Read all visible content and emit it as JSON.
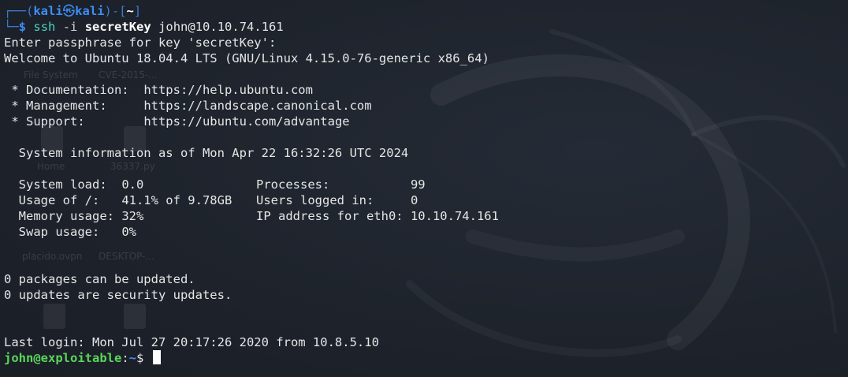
{
  "prompt": {
    "frame_top_left": "┌──(",
    "user": "kali",
    "skull": "㉿",
    "host": "kali",
    "frame_mid": ")-[",
    "dir": "~",
    "frame_close": "]",
    "frame_bottom": "└─",
    "dollar": "$"
  },
  "command": {
    "name": "ssh",
    "flag": "-i",
    "key": "secretKey",
    "target": "john@10.10.74.161"
  },
  "output": {
    "passphrase": "Enter passphrase for key 'secretKey':",
    "welcome": "Welcome to Ubuntu 18.04.4 LTS (GNU/Linux 4.15.0-76-generic x86_64)",
    "links": [
      {
        "label": " * Documentation:  ",
        "url": "https://help.ubuntu.com"
      },
      {
        "label": " * Management:     ",
        "url": "https://landscape.canonical.com"
      },
      {
        "label": " * Support:        ",
        "url": "https://ubuntu.com/advantage"
      }
    ],
    "sysinfo_header": "  System information as of Mon Apr 22 16:32:26 UTC 2024",
    "stats": {
      "system_load_label": "  System load:  ",
      "system_load_value": "0.0",
      "processes_label": "Processes:           ",
      "processes_value": "99",
      "usage_label": "  Usage of /:   ",
      "usage_value": "41.1% of 9.78GB",
      "users_label": "Users logged in:     ",
      "users_value": "0",
      "memory_label": "  Memory usage: ",
      "memory_value": "32%",
      "ip_label": "IP address for eth0: ",
      "ip_value": "10.10.74.161",
      "swap_label": "  Swap usage:   ",
      "swap_value": "0%"
    },
    "packages": "0 packages can be updated.",
    "security": "0 updates are security updates.",
    "last_login": "Last login: Mon Jul 27 20:17:26 2020 from 10.8.5.10"
  },
  "remote_prompt": {
    "user_host": "john@exploitable",
    "colon": ":",
    "path": "~",
    "dollar": "$ "
  },
  "desktop_ghosts": {
    "file_system": "File System",
    "cve": "CVE-2015-...",
    "home": "Home",
    "py": "36337.py",
    "ovpn": "placido.ovpn",
    "desktop": "DESKTOP-..."
  },
  "colors": {
    "background": "#1e232c",
    "prompt_blue": "#3d8df5",
    "remote_user_green": "#5ad65a",
    "text": "#e6e6e6"
  }
}
